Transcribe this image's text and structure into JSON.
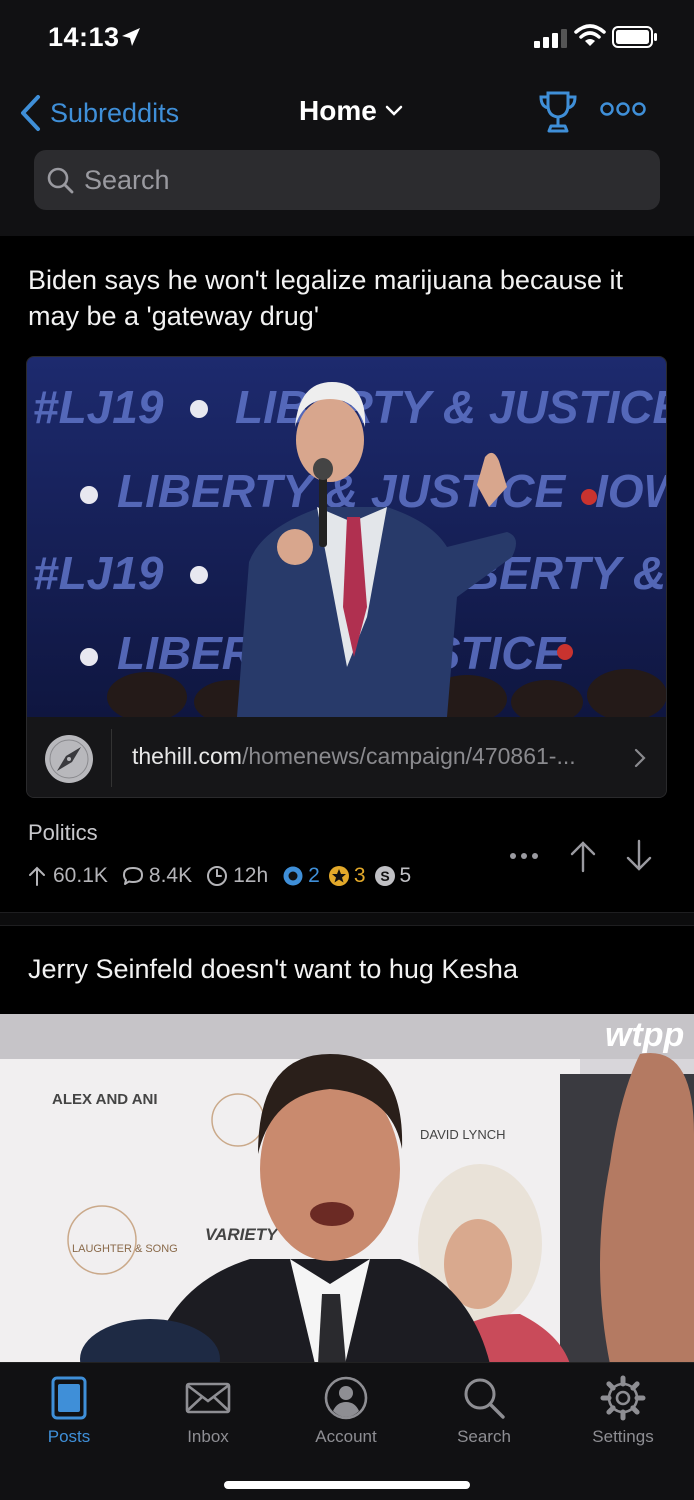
{
  "status_bar": {
    "time": "14:13",
    "location_icon": "location-arrow-icon",
    "signal_icon": "cellular-signal-icon",
    "wifi_icon": "wifi-icon",
    "battery_icon": "battery-icon"
  },
  "nav": {
    "back_label": "Subreddits",
    "title": "Home",
    "trophy_icon": "trophy-icon",
    "more_icon": "more-icon"
  },
  "search": {
    "placeholder": "Search"
  },
  "posts": [
    {
      "title": "Biden says he won't legalize marijuana because it may be a 'gateway drug'",
      "link_domain": "thehill.com",
      "link_path": "/homenews/campaign/470861-...",
      "subreddit": "Politics",
      "upvotes": "60.1K",
      "comments": "8.4K",
      "age": "12h",
      "awards": [
        {
          "type": "silver",
          "count": "2",
          "color": "#3f8fd8"
        },
        {
          "type": "gold",
          "count": "3",
          "color": "#e3a92a"
        },
        {
          "type": "platinum",
          "count": "5",
          "color": "#c0c0c4"
        }
      ],
      "backdrop_words": [
        "#LJ19",
        "LIBERTY & JUSTICE",
        "LIBERTY & JUSTICE",
        "IOWA"
      ]
    },
    {
      "title": "Jerry Seinfeld doesn't want to hug Kesha",
      "watermark": "wtpp",
      "banner_words": [
        "ALEX AND ANI",
        "LAUGHTER & SONG",
        "DAVID LYNCH",
        "VARIETY"
      ]
    }
  ],
  "tabs": [
    {
      "label": "Posts",
      "icon": "posts-icon",
      "active": true
    },
    {
      "label": "Inbox",
      "icon": "inbox-icon",
      "active": false
    },
    {
      "label": "Account",
      "icon": "account-icon",
      "active": false
    },
    {
      "label": "Search",
      "icon": "search-icon",
      "active": false
    },
    {
      "label": "Settings",
      "icon": "settings-icon",
      "active": false
    }
  ],
  "colors": {
    "accent": "#3f8fd8",
    "background": "#000000",
    "bar": "#111113"
  }
}
